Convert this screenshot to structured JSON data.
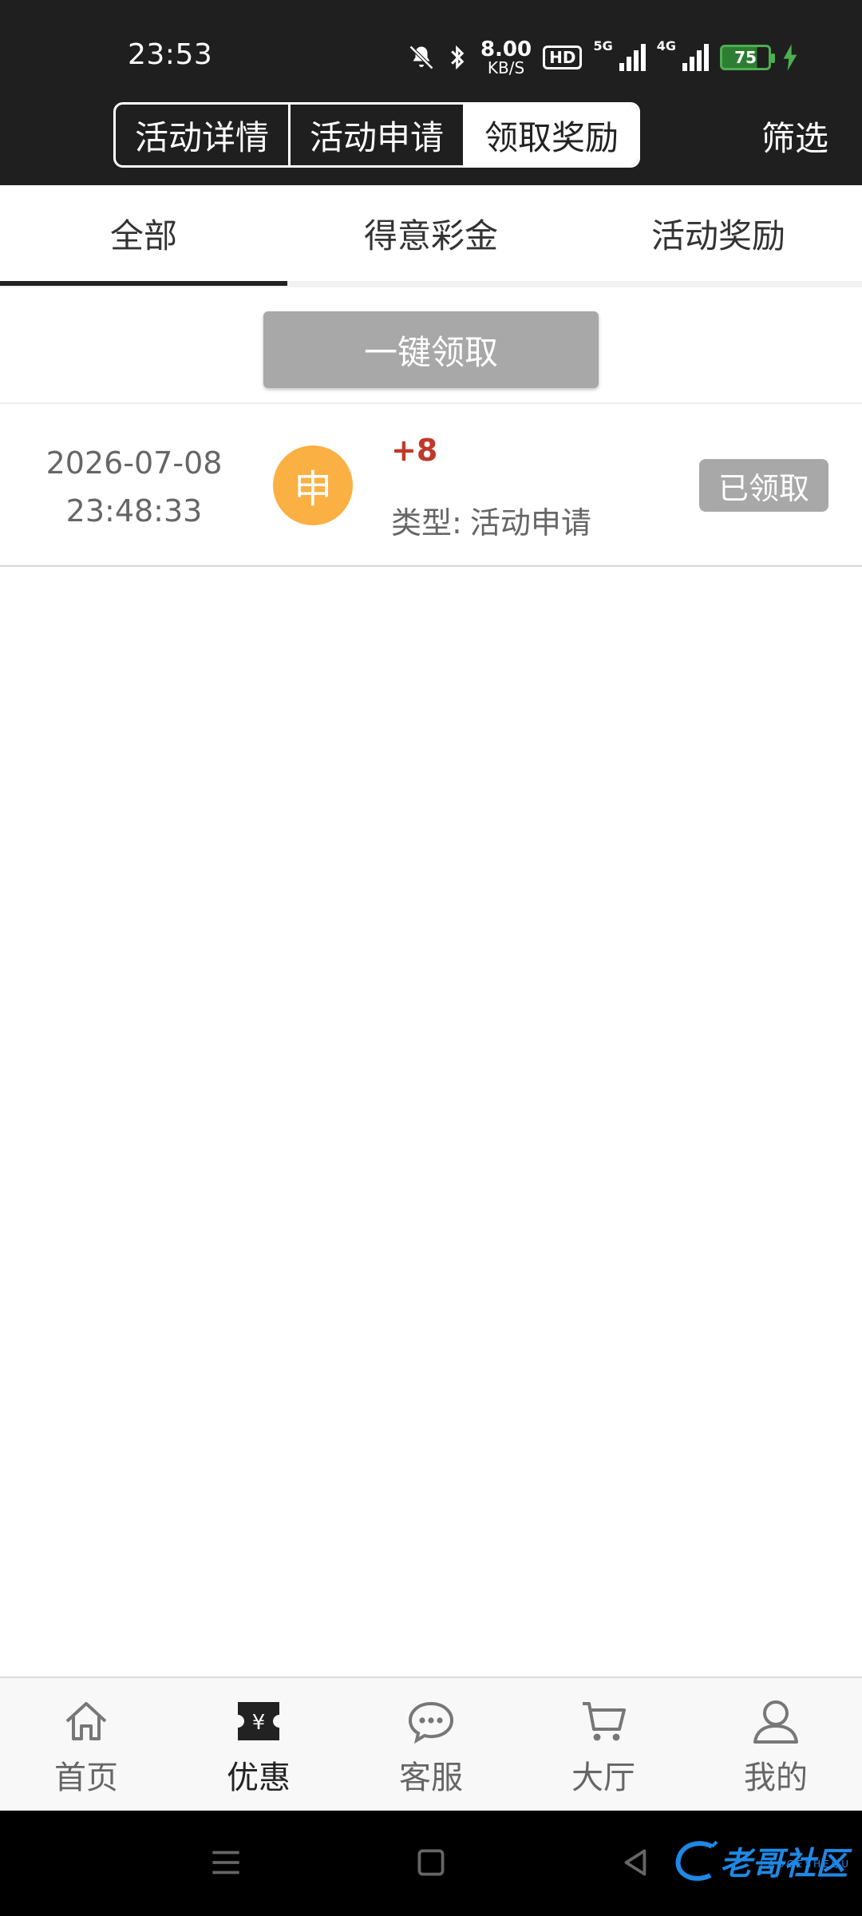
{
  "status_bar": {
    "time": "23:53",
    "speed_value": "8.00",
    "speed_unit": "KB/S",
    "hd_label": "HD",
    "network_5g": "5G",
    "network_4g": "4G",
    "battery": "75"
  },
  "header": {
    "segments": [
      "活动详情",
      "活动申请",
      "领取奖励"
    ],
    "active_segment": "领取奖励",
    "filter_label": "筛选"
  },
  "sub_tabs": {
    "items": [
      "全部",
      "得意彩金",
      "活动奖励"
    ],
    "active": "全部"
  },
  "claim_all_label": "一键领取",
  "records": [
    {
      "date": "2026-07-08",
      "time": "23:48:33",
      "badge": "申",
      "amount": "+8",
      "type_label": "类型:",
      "type_value": "活动申请",
      "status": "已领取"
    }
  ],
  "tab_bar": {
    "items": [
      {
        "label": "首页",
        "icon": "home-icon"
      },
      {
        "label": "优惠",
        "icon": "coupon-icon"
      },
      {
        "label": "客服",
        "icon": "chat-icon"
      },
      {
        "label": "大厅",
        "icon": "cart-icon"
      },
      {
        "label": "我的",
        "icon": "user-icon"
      }
    ],
    "active": "优惠"
  },
  "watermark": {
    "text": "老哥社区",
    "sub": "LAOGESHEQU"
  },
  "colors": {
    "header_bg": "#1f1f1f",
    "amount": "#c0392b",
    "badge": "#fbb044",
    "button_gray": "#a8a8a8"
  }
}
